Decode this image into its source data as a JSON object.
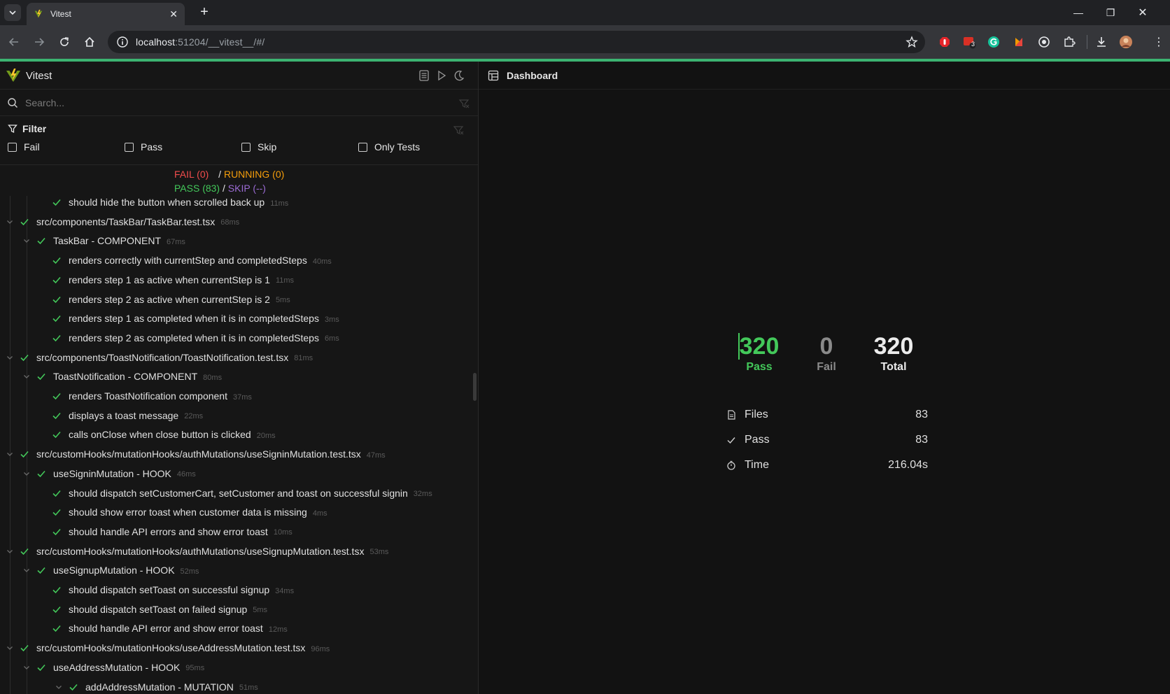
{
  "browser": {
    "tab_title": "Vitest",
    "url_host": "localhost",
    "url_rest": ":51204/__vitest__/#/",
    "ext_badge": "3"
  },
  "app": {
    "brand": "Vitest",
    "search_placeholder": "Search...",
    "filter_title": "Filter",
    "filters": [
      "Fail",
      "Pass",
      "Skip",
      "Only Tests"
    ],
    "summary": {
      "fail": "FAIL (0)",
      "sep1": "/",
      "running": "RUNNING (0)",
      "pass": "PASS (83)",
      "sep2": "/",
      "skip": "SKIP (--)"
    }
  },
  "tree": [
    {
      "label": "should hide the button when scrolled back up",
      "dur": "11ms",
      "level": 2,
      "chev": false
    },
    {
      "label": "src/components/TaskBar/TaskBar.test.tsx",
      "dur": "68ms",
      "level": 0,
      "chev": true
    },
    {
      "label": "TaskBar - COMPONENT",
      "dur": "67ms",
      "level": 1,
      "chev": true
    },
    {
      "label": "renders correctly with currentStep and completedSteps",
      "dur": "40ms",
      "level": 2,
      "chev": false
    },
    {
      "label": "renders step 1 as active when currentStep is 1",
      "dur": "11ms",
      "level": 2,
      "chev": false
    },
    {
      "label": "renders step 2 as active when currentStep is 2",
      "dur": "5ms",
      "level": 2,
      "chev": false
    },
    {
      "label": "renders step 1 as completed when it is in completedSteps",
      "dur": "3ms",
      "level": 2,
      "chev": false
    },
    {
      "label": "renders step 2 as completed when it is in completedSteps",
      "dur": "6ms",
      "level": 2,
      "chev": false
    },
    {
      "label": "src/components/ToastNotification/ToastNotification.test.tsx",
      "dur": "81ms",
      "level": 0,
      "chev": true
    },
    {
      "label": "ToastNotification - COMPONENT",
      "dur": "80ms",
      "level": 1,
      "chev": true
    },
    {
      "label": "renders ToastNotification component",
      "dur": "37ms",
      "level": 2,
      "chev": false
    },
    {
      "label": "displays a toast message",
      "dur": "22ms",
      "level": 2,
      "chev": false
    },
    {
      "label": "calls onClose when close button is clicked",
      "dur": "20ms",
      "level": 2,
      "chev": false
    },
    {
      "label": "src/customHooks/mutationHooks/authMutations/useSigninMutation.test.tsx",
      "dur": "47ms",
      "level": 0,
      "chev": true
    },
    {
      "label": "useSigninMutation - HOOK",
      "dur": "46ms",
      "level": 1,
      "chev": true
    },
    {
      "label": "should dispatch setCustomerCart, setCustomer and toast on successful signin",
      "dur": "32ms",
      "level": 2,
      "chev": false
    },
    {
      "label": "should show error toast when customer data is missing",
      "dur": "4ms",
      "level": 2,
      "chev": false
    },
    {
      "label": "should handle API errors and show error toast",
      "dur": "10ms",
      "level": 2,
      "chev": false
    },
    {
      "label": "src/customHooks/mutationHooks/authMutations/useSignupMutation.test.tsx",
      "dur": "53ms",
      "level": 0,
      "chev": true
    },
    {
      "label": "useSignupMutation - HOOK",
      "dur": "52ms",
      "level": 1,
      "chev": true
    },
    {
      "label": "should dispatch setToast on successful signup",
      "dur": "34ms",
      "level": 2,
      "chev": false
    },
    {
      "label": "should dispatch setToast on failed signup",
      "dur": "5ms",
      "level": 2,
      "chev": false
    },
    {
      "label": "should handle API error and show error toast",
      "dur": "12ms",
      "level": 2,
      "chev": false
    },
    {
      "label": "src/customHooks/mutationHooks/useAddressMutation.test.tsx",
      "dur": "96ms",
      "level": 0,
      "chev": true
    },
    {
      "label": "useAddressMutation - HOOK",
      "dur": "95ms",
      "level": 1,
      "chev": true
    },
    {
      "label": "addAddressMutation - MUTATION",
      "dur": "51ms",
      "level": 2,
      "chev": true
    }
  ],
  "dashboard": {
    "title": "Dashboard",
    "stats": [
      {
        "num": "320",
        "cap": "Pass",
        "color": "#43c85a"
      },
      {
        "num": "0",
        "cap": "Fail",
        "color": "#8a8a8a"
      },
      {
        "num": "320",
        "cap": "Total",
        "color": "#ececec"
      }
    ],
    "info": [
      {
        "key": "Files",
        "value": "83",
        "icon": "file-icon"
      },
      {
        "key": "Pass",
        "value": "83",
        "icon": "check-icon"
      },
      {
        "key": "Time",
        "value": "216.04s",
        "icon": "timer-icon"
      }
    ]
  },
  "colors": {
    "accent": "#43c85a",
    "fail": "#f14c4c",
    "running": "#f59e0b",
    "skip": "#9b6bd4"
  }
}
